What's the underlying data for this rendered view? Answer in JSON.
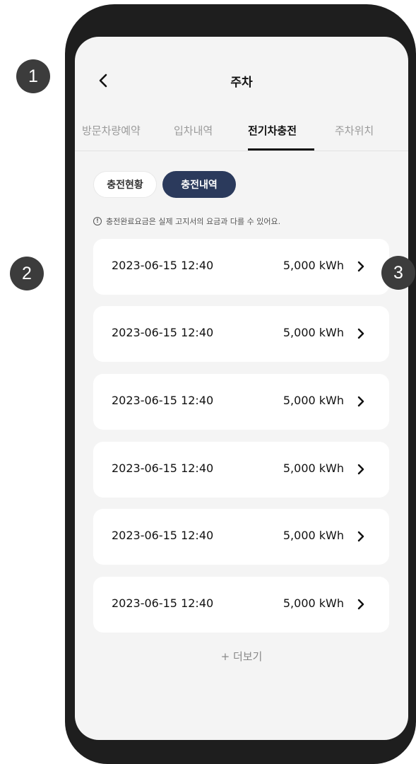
{
  "markers": [
    "1",
    "2",
    "3"
  ],
  "header": {
    "title": "주차",
    "back_icon": "chevron-left-icon"
  },
  "tabs": [
    {
      "label": "방문차량예약",
      "active": false
    },
    {
      "label": "입차내역",
      "active": false
    },
    {
      "label": "전기차충전",
      "active": true
    },
    {
      "label": "주차위치",
      "active": false
    }
  ],
  "segments": [
    {
      "label": "충전현황",
      "active": false
    },
    {
      "label": "충전내역",
      "active": true
    }
  ],
  "notice": {
    "icon": "!",
    "text": "충전완료요금은 실제 고지서의 요금과 다를 수 있어요."
  },
  "history": [
    {
      "datetime": "2023-06-15 12:40",
      "energy": "5,000 kWh"
    },
    {
      "datetime": "2023-06-15 12:40",
      "energy": "5,000 kWh"
    },
    {
      "datetime": "2023-06-15 12:40",
      "energy": "5,000 kWh"
    },
    {
      "datetime": "2023-06-15 12:40",
      "energy": "5,000 kWh"
    },
    {
      "datetime": "2023-06-15 12:40",
      "energy": "5,000 kWh"
    },
    {
      "datetime": "2023-06-15 12:40",
      "energy": "5,000 kWh"
    }
  ],
  "more_label": "+ 더보기",
  "colors": {
    "accent": "#2b3a5c",
    "frame": "#1e1e1e",
    "screen": "#f4f4f4",
    "marker": "#3c3c3c"
  }
}
